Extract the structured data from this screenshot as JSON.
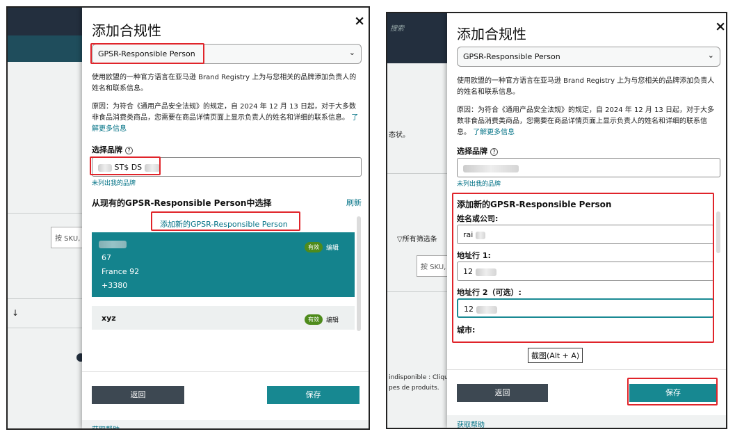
{
  "common": {
    "title": "添加合规性",
    "close_icon": "×",
    "select_value": "GPSR-Responsible Person",
    "desc": "使用欧盟的一种官方语言在亚马逊 Brand Registry 上为与您相关的品牌添加负责人的姓名和联系信息。",
    "reason": "原因：为符合《通用产品安全法规》的规定，自 2024 年 12 月 13 日起，对于大多数非食品消费类商品，您需要在商品详情页面上显示负责人的姓名和详细的联系信息。",
    "learn_more": "了解更多信息",
    "brand_label": "选择品牌",
    "help_glyph": "?",
    "brand_not_listed": "未列出我的品牌",
    "back": "返回",
    "save": "保存",
    "get_help": "获取帮助"
  },
  "left": {
    "brand_value_fragment": "ST$ DS",
    "choose_heading": "从现有的GPSR-Responsible Person中选择",
    "refresh": "刷新",
    "add_new": "添加新的GPSR-Responsible Person",
    "card1": {
      "line_b": "67",
      "line_c": "France 92",
      "line_d": "+3380",
      "status": "有效",
      "edit": "编辑"
    },
    "card2": {
      "name": "xyz",
      "status": "有效",
      "edit": "编辑"
    },
    "bg_search_placeholder": "按 SKU,",
    "bg_arrow": "↓"
  },
  "right": {
    "bg_search": "搜索",
    "bg_status": "态状。",
    "bg_filter": "所有筛选条",
    "bg_search_placeholder": "按 SKU,",
    "bg_fr1": "indisponible : Cliqu",
    "bg_fr2": "pes de produits.",
    "add_heading": "添加新的GPSR-Responsible Person",
    "name_label": "姓名或公司:",
    "name_value": "rai",
    "addr1_label": "地址行 1:",
    "addr1_value": "12",
    "addr2_label": "地址行 2（可选）:",
    "addr2_value": "12",
    "city_label": "城市:",
    "tooltip": "截图(Alt + A)"
  }
}
